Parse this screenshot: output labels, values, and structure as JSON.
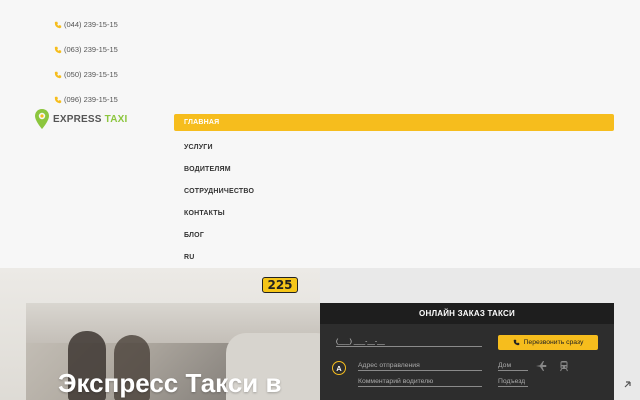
{
  "header": {
    "phones": [
      "(044) 239-15-15",
      "(063) 239-15-15",
      "(050) 239-15-15",
      "(096) 239-15-15"
    ],
    "logo": {
      "word1": "EXPRESS",
      "word2": "TAXI"
    }
  },
  "nav": {
    "items": [
      "ГЛАВНАЯ",
      "УСЛУГИ",
      "ВОДИТЕЛЯМ",
      "СОТРУДНИЧЕСТВО",
      "КОНТАКТЫ",
      "БЛОГ",
      "RU"
    ],
    "active_index": 0
  },
  "hero": {
    "title": "Экспресс Такси в",
    "taxi_sign": "225"
  },
  "order": {
    "title": "ОНЛАЙН ЗАКАЗ ТАКСИ",
    "phone_mask": "(___) ___-__-__",
    "callback_label": "Перезвонить сразу",
    "marker": "A",
    "address_placeholder": "Адрес отправления",
    "comment_placeholder": "Комментарий водителю",
    "house_placeholder": "Дом",
    "entrance_placeholder": "Подъезд"
  },
  "colors": {
    "accent": "#f6bd1d",
    "logo_green": "#8cc63e",
    "form_bg": "#2d2d2d"
  },
  "icons": [
    "phone-icon",
    "map-pin-icon",
    "plane-icon",
    "train-icon"
  ]
}
